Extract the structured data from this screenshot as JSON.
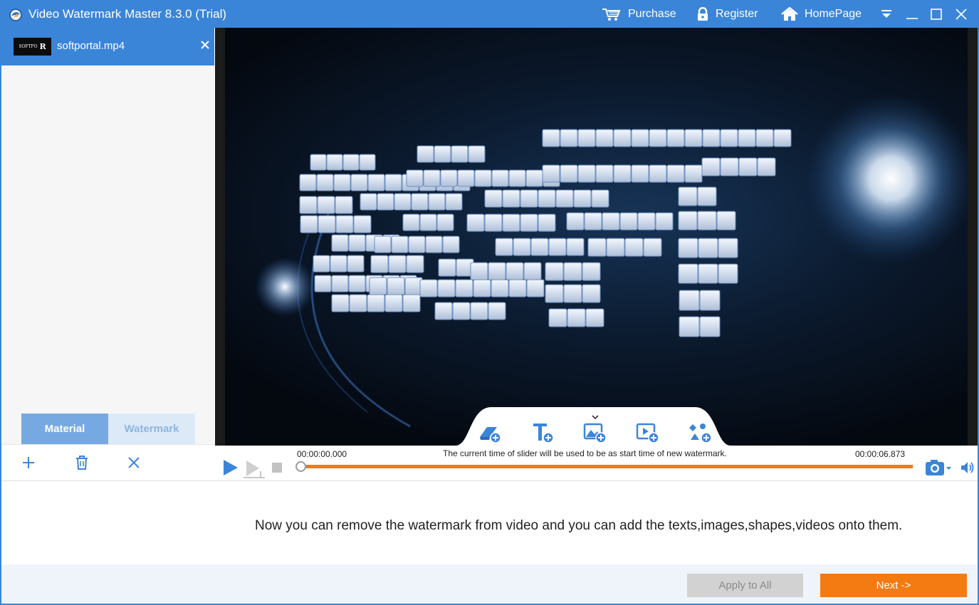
{
  "window": {
    "title": "Video Watermark Master 8.3.0 (Trial)",
    "accent_color": "#3b85d9"
  },
  "titlebar": {
    "purchase_label": "Purchase",
    "register_label": "Register",
    "homepage_label": "HomePage",
    "icons": [
      "app-icon",
      "cart-icon",
      "lock-icon",
      "home-icon",
      "dropdown-menu-icon",
      "minimize-icon",
      "maximize-icon",
      "close-icon"
    ]
  },
  "file_list": {
    "items": [
      {
        "name": "softportal.mp4",
        "thumb_text": "SOFTPO",
        "thumb_letter": "R",
        "selected": true
      }
    ]
  },
  "left_tabs": {
    "material_label": "Material",
    "watermark_label": "Watermark",
    "active": "Material"
  },
  "left_tools": {
    "icons": [
      "add-icon",
      "trash-icon",
      "remove-icon"
    ]
  },
  "watermark_tools": {
    "icons": [
      "eraser-add-icon",
      "text-add-icon",
      "image-add-icon",
      "video-add-icon",
      "shape-add-icon"
    ]
  },
  "timeline": {
    "start_time": "00:00:00.000",
    "end_time": "00:00:06.873",
    "hint": "The current time of slider will be used to be as start time of new watermark.",
    "position_fraction": 0.0,
    "track_color": "#f07a17",
    "icons": [
      "play-icon",
      "step-forward-icon",
      "stop-icon",
      "camera-icon",
      "volume-icon"
    ]
  },
  "message": {
    "text": "Now you can remove the watermark from video and you can add the texts,images,shapes,videos onto them."
  },
  "footer": {
    "apply_label": "Apply to All",
    "next_label": "Next ->",
    "next_color": "#f47a12"
  }
}
